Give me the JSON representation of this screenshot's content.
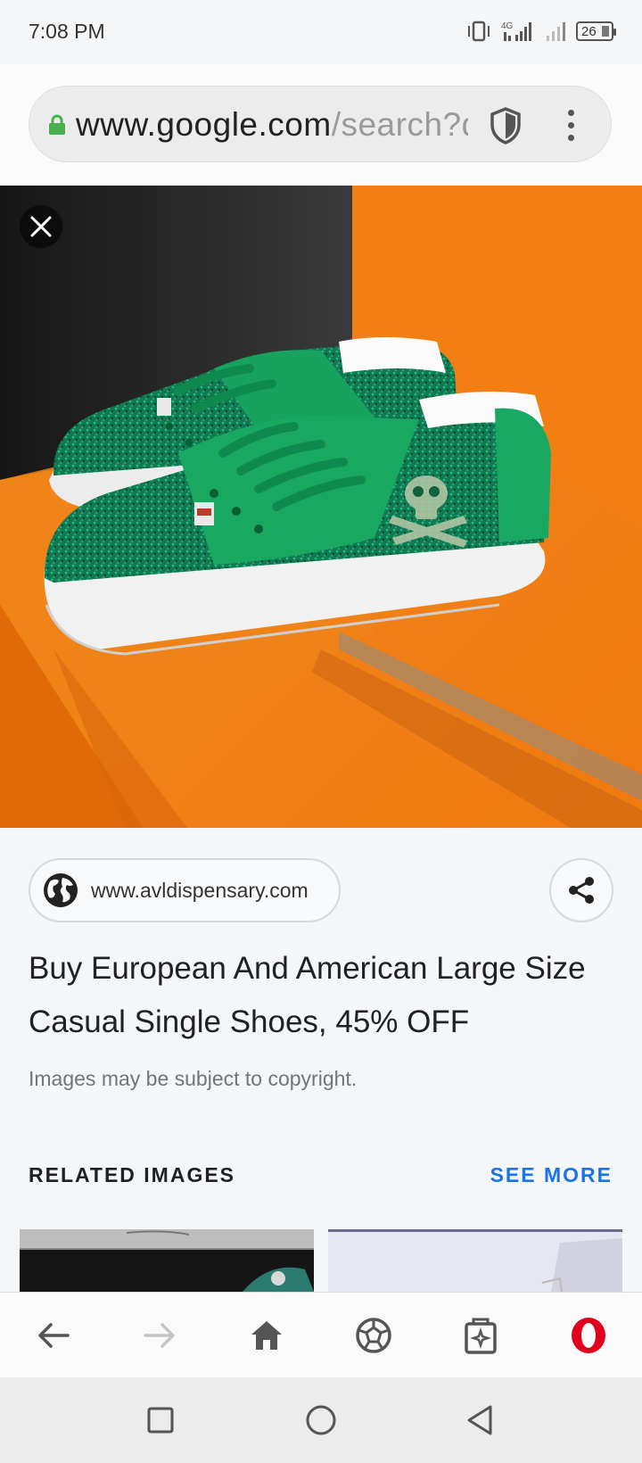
{
  "status_bar": {
    "time": "7:08 PM",
    "network": "4G",
    "battery": "26"
  },
  "browser": {
    "url_domain": "www.google.com",
    "url_path": "/search?q"
  },
  "viewer": {
    "image_alt": "Green rhinestone sneakers with skull emblem on orange box"
  },
  "result": {
    "source": "www.avldispensary.com",
    "title": "Buy European And American Large Size Casual Single Shoes, 45% OFF",
    "copyright_note": "Images may be subject to copyright."
  },
  "related": {
    "label": "RELATED IMAGES",
    "see_more": "SEE MORE"
  },
  "colors": {
    "accent": "#1a73e8",
    "opera_red": "#e0001b",
    "lock_green": "#4caf50"
  },
  "icons": {
    "back": "back-arrow-icon",
    "forward": "forward-arrow-icon",
    "home": "home-icon",
    "speed_dial": "speed-dial-icon",
    "tabs": "tabs-icon",
    "opera_menu": "opera-logo-icon"
  }
}
